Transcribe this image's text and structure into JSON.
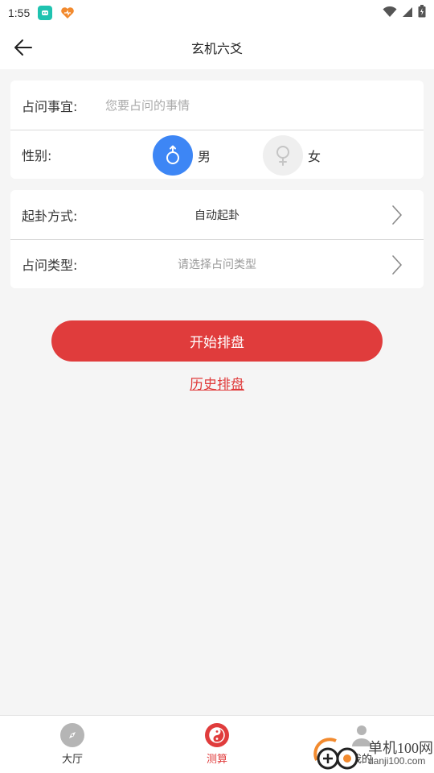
{
  "status_bar": {
    "time": "1:55",
    "icons": [
      "app-icon-teal",
      "app-icon-heart",
      "wifi-icon",
      "signal-icon",
      "battery-icon"
    ]
  },
  "header": {
    "title": "玄机六爻",
    "back_icon": "arrow-left-icon"
  },
  "form": {
    "question": {
      "label": "占问事宜:",
      "value": "",
      "placeholder": "您要占问的事情"
    },
    "gender": {
      "label": "性别:",
      "options": [
        {
          "label": "男",
          "icon": "male-icon",
          "selected": true
        },
        {
          "label": "女",
          "icon": "female-icon",
          "selected": false
        }
      ]
    },
    "method": {
      "label": "起卦方式:",
      "value": "自动起卦"
    },
    "type": {
      "label": "占问类型:",
      "placeholder": "请选择占问类型"
    }
  },
  "actions": {
    "start_label": "开始排盘",
    "history_label": "历史排盘"
  },
  "tab_bar": {
    "items": [
      {
        "label": "大厅",
        "icon": "compass-icon",
        "active": false
      },
      {
        "label": "测算",
        "icon": "yin-yang-icon",
        "active": true
      },
      {
        "label": "我的",
        "icon": "user-icon",
        "active": false
      }
    ]
  },
  "watermark": {
    "main": "单机100网",
    "sub": "danji100.com"
  },
  "colors": {
    "accent_red": "#e03c3c",
    "selected_blue": "#3d86f5",
    "background": "#f5f5f5"
  }
}
